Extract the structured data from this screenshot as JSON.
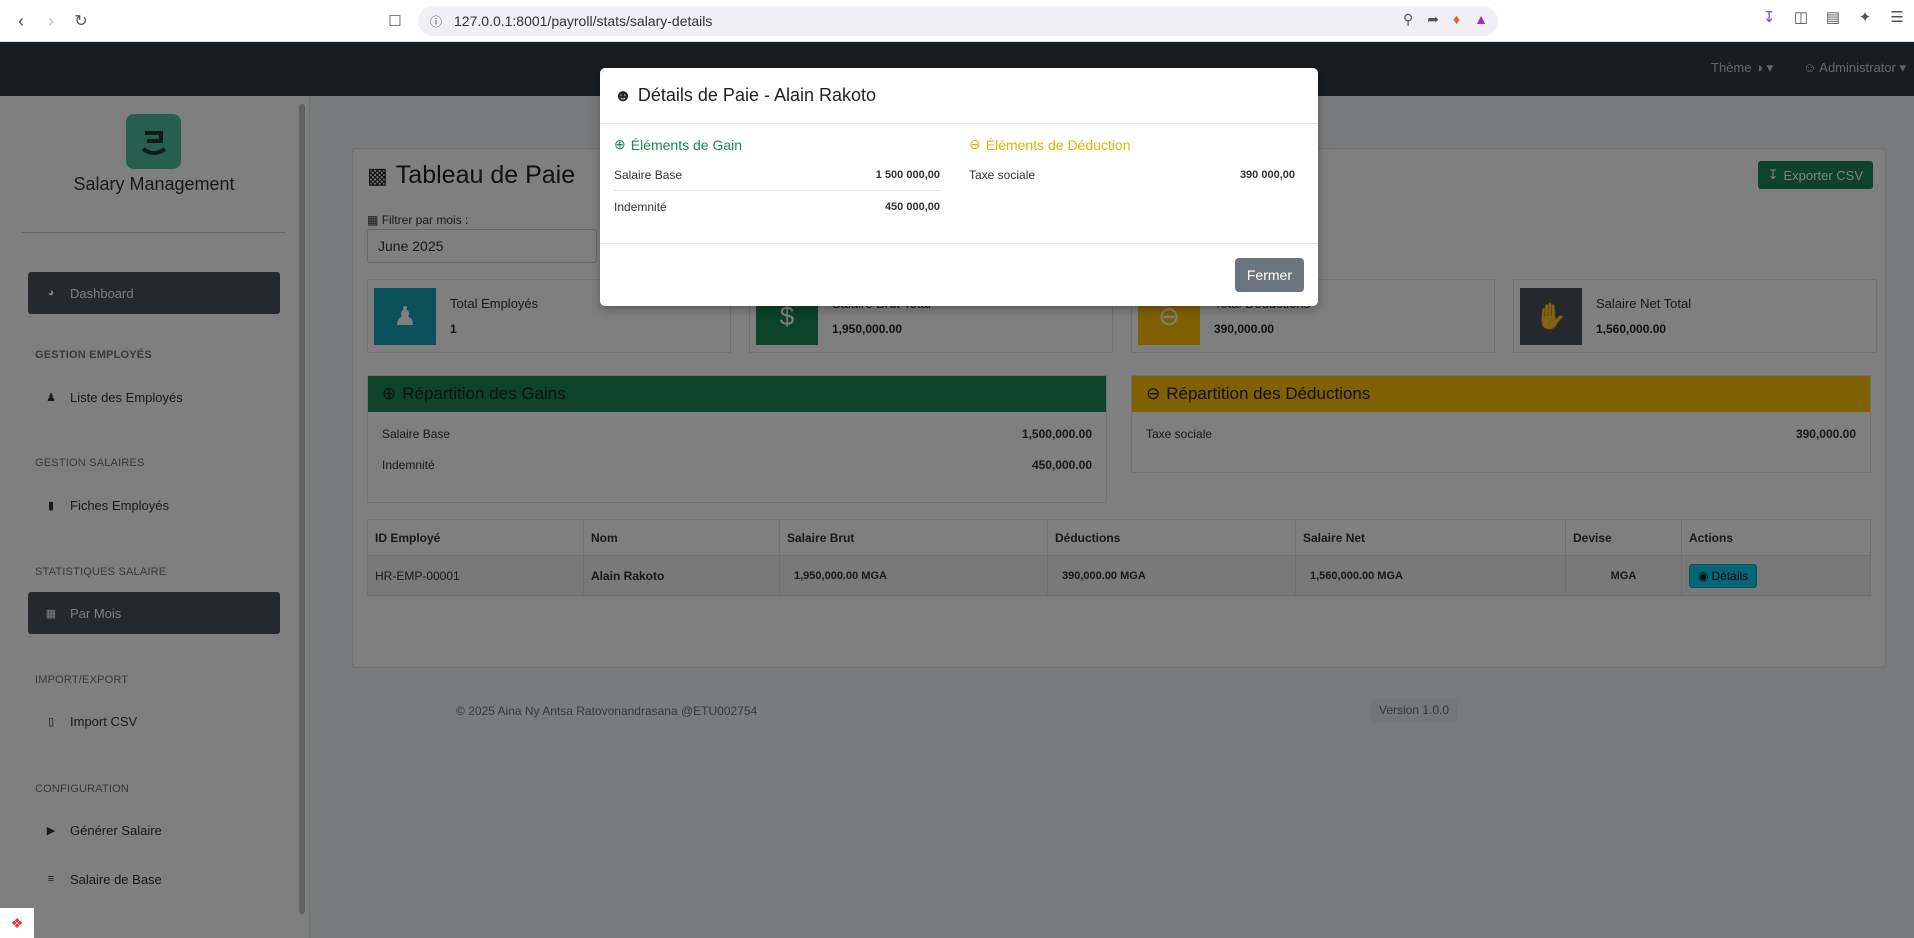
{
  "browser": {
    "url": "127.0.0.1:8001/payroll/stats/salary-details"
  },
  "topnav": {
    "theme_label": "Thème",
    "user_label": "Administrator"
  },
  "sidebar": {
    "brand": "Salary Management",
    "items": {
      "dashboard": "Dashboard",
      "section_employes": "GESTION EMPLOYÉS",
      "liste_employes": "Liste des Employés",
      "section_salaires": "GESTION SALAIRES",
      "fiches_employes": "Fiches Employés",
      "section_stats": "STATISTIQUES SALAIRE",
      "par_mois": "Par Mois",
      "section_import": "IMPORT/EXPORT",
      "import_csv": "Import CSV",
      "section_config": "CONFIGURATION",
      "generer_salaire": "Générer Salaire",
      "salaire_base": "Salaire de Base"
    }
  },
  "page": {
    "title": "Tableau de Paie",
    "export_label": "Exporter CSV",
    "filter_label": "Filtrer par mois :",
    "filter_value": "June 2025"
  },
  "stats": {
    "total_employes_label": "Total Employés",
    "total_employes_value": "1",
    "brut_label": "Salaire Brut Total",
    "brut_value": "1,950,000.00",
    "deductions_label": "Total Déductions",
    "deductions_value": "390,000.00",
    "net_label": "Salaire Net Total",
    "net_value": "1,560,000.00"
  },
  "gains": {
    "title": "Répartition des Gains",
    "rows": [
      {
        "label": "Salaire Base",
        "amount": "1,500,000.00"
      },
      {
        "label": "Indemnité",
        "amount": "450,000.00"
      }
    ]
  },
  "deductions": {
    "title": "Répartition des Déductions",
    "rows": [
      {
        "label": "Taxe sociale",
        "amount": "390,000.00"
      }
    ]
  },
  "table": {
    "headers": [
      "ID Employé",
      "Nom",
      "Salaire Brut",
      "Déductions",
      "Salaire Net",
      "Devise",
      "Actions"
    ],
    "rows": [
      {
        "id": "HR-EMP-00001",
        "nom": "Alain Rakoto",
        "brut": "1,950,000.00 MGA",
        "deductions": "390,000.00 MGA",
        "net": "1,560,000.00 MGA",
        "devise": "MGA",
        "action": "Détails"
      }
    ]
  },
  "footer": {
    "text": "© 2025 Aina Ny Antsa Ratovonandrasana @ETU002754",
    "version": "Version 1.0.0"
  },
  "modal": {
    "title": "Détails de Paie - Alain Rakoto",
    "gains_title": "Éléments de Gain",
    "gains": [
      {
        "label": "Salaire Base",
        "amount": "1 500 000,00"
      },
      {
        "label": "Indemnité",
        "amount": "450 000,00"
      }
    ],
    "deductions_title": "Éléments de Déduction",
    "deductions": [
      {
        "label": "Taxe sociale",
        "amount": "390 000,00"
      }
    ],
    "close_label": "Fermer"
  },
  "colors": {
    "success": "#198754",
    "warning": "#ffc107",
    "info": "#0dcaf0",
    "dark": "#343a40"
  }
}
